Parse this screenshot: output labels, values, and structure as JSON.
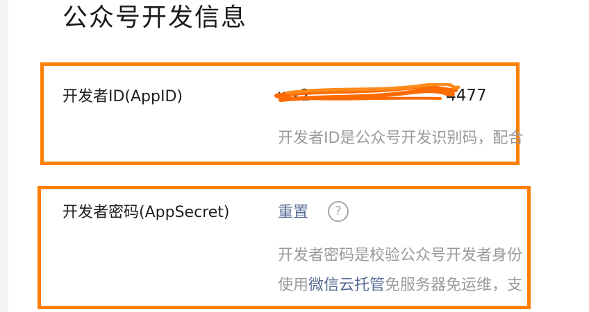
{
  "page": {
    "title": "公众号开发信息"
  },
  "app_id": {
    "label": "开发者ID(AppID)",
    "value_visible": "wx2",
    "value_tail": "4477",
    "description": "开发者ID是公众号开发识别码，配合"
  },
  "app_secret": {
    "label": "开发者密码(AppSecret)",
    "reset_label": "重置",
    "help_symbol": "?",
    "description_line1": "开发者密码是校验公众号开发者身份",
    "description_line2_prefix": "使用",
    "description_line2_link": "微信云托管",
    "description_line2_suffix": "免服务器免运维，支"
  },
  "colors": {
    "highlight": "#ff7f00",
    "link": "#576b95",
    "muted": "#9a9a9a"
  },
  "icons": [
    "help-icon"
  ]
}
